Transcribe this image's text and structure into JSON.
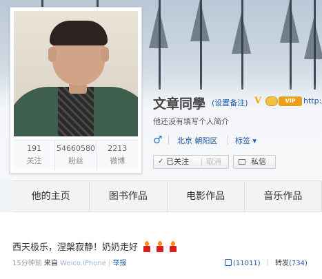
{
  "profile": {
    "name": "文章同學",
    "remark": "(设置备注)",
    "link": "http:/",
    "bio": "他还没有填写个人简介",
    "gender_symbol": "♂",
    "location": "北京 朝阳区",
    "tags_label": "标签 ▾",
    "stats": [
      {
        "num": "191",
        "label": "关注"
      },
      {
        "num": "54660580",
        "label": "粉丝"
      },
      {
        "num": "2213",
        "label": "微博"
      }
    ]
  },
  "buttons": {
    "followed_check": "✓",
    "followed": "已关注",
    "cancel": "取消",
    "message": "私信"
  },
  "tabs": [
    "他的主页",
    "图书作品",
    "电影作品",
    "音乐作品"
  ],
  "post": {
    "text": "西天极乐，涅槃寂静！奶奶走好",
    "time": "15分钟前",
    "from_label": "来自",
    "app": "Weico.iPhone",
    "report": "举报",
    "like_count": "(11011)",
    "repost_label": "转发",
    "repost_count": "(734)"
  },
  "colors": {
    "link": "#1e5aa8",
    "vip_orange": "#e9a11a",
    "candle_red": "#d81e1e"
  }
}
